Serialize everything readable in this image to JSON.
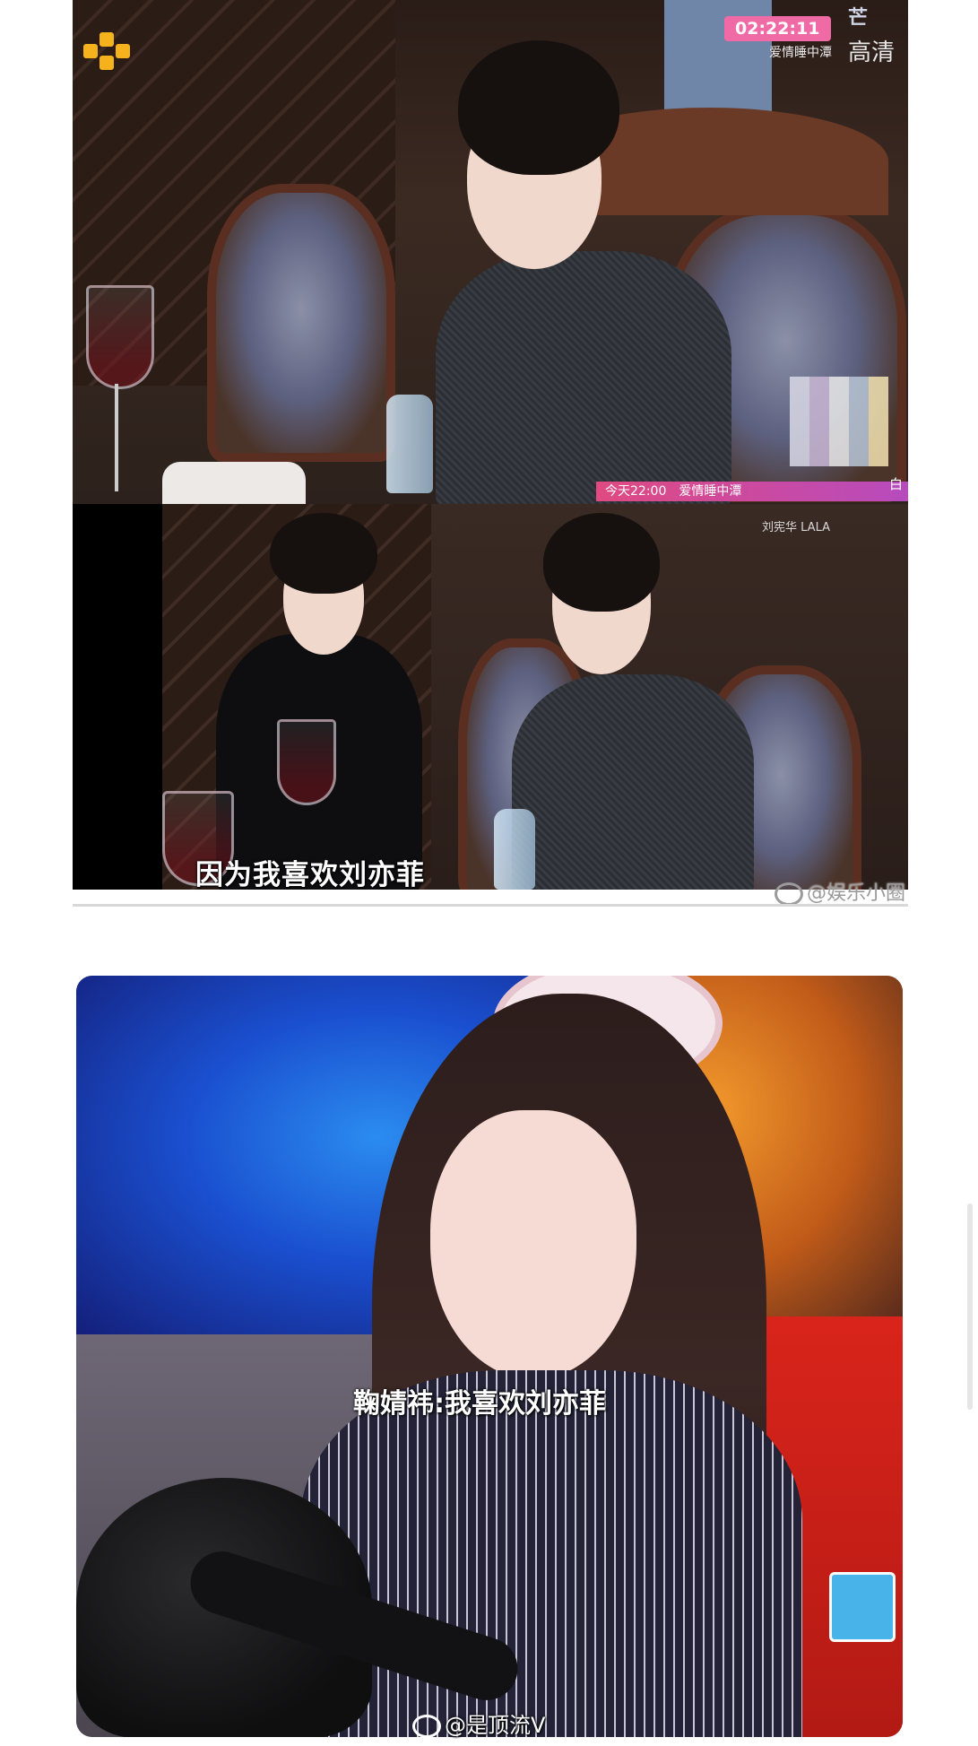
{
  "top_image": {
    "broadcast_time": "02:22:11",
    "channel_text": "爱情睡中潭",
    "quality_label": "高清",
    "corner_logo": "芒",
    "promo": {
      "text": "今天22:00　爱情睡中潭",
      "tail": "白"
    },
    "name_tag": "刘宪华 LALA",
    "subtitle": "因为我喜欢刘亦菲",
    "watermark": "@娱乐小圈"
  },
  "bottom_image": {
    "subtitle": "鞠婧祎:我喜欢刘亦菲",
    "watermark": "@是顶流V"
  },
  "icons": {
    "tv_logo": "mango-tv-logo-icon",
    "weibo": "weibo-icon"
  },
  "colors": {
    "time_badge": "#f06aa5",
    "promo_bar": "#e04a82",
    "logo": "#f5b21c"
  }
}
